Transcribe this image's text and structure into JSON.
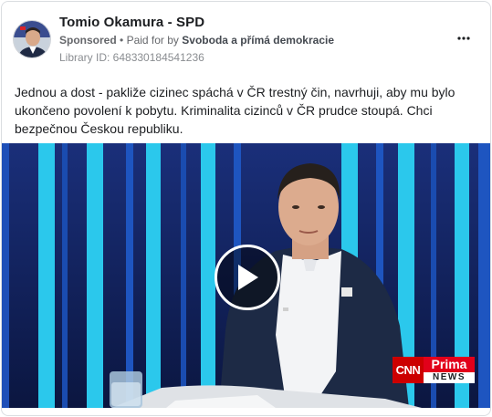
{
  "ad": {
    "page_name": "Tomio Okamura - SPD",
    "sponsored": "Sponsored",
    "separator": "•",
    "paid_for_by": "Paid for by",
    "payer": "Svoboda a přímá demokracie",
    "library_id": "Library ID: 648330184541236",
    "body": "Jednou a dost - pakliže cizinec spáchá v ČR trestný čin, navrhuji, aby mu bylo ukončeno povolení k pobytu. Kriminalita cizinců v ČR prudce stoupá. Chci bezpečnou Českou republiku."
  },
  "video": {
    "logo_cnn": "CNN",
    "logo_prima": "Prima",
    "logo_news": "NEWS"
  },
  "icons": {
    "more": "more-horizontal-icon",
    "play": "play-icon"
  },
  "colors": {
    "text_primary": "#1c1e21",
    "text_secondary": "#65676b",
    "studio_blue": "#0a1a4a",
    "studio_cyan": "#23c3e6",
    "cnn_red": "#cc0000",
    "prima_red": "#e2001a"
  }
}
